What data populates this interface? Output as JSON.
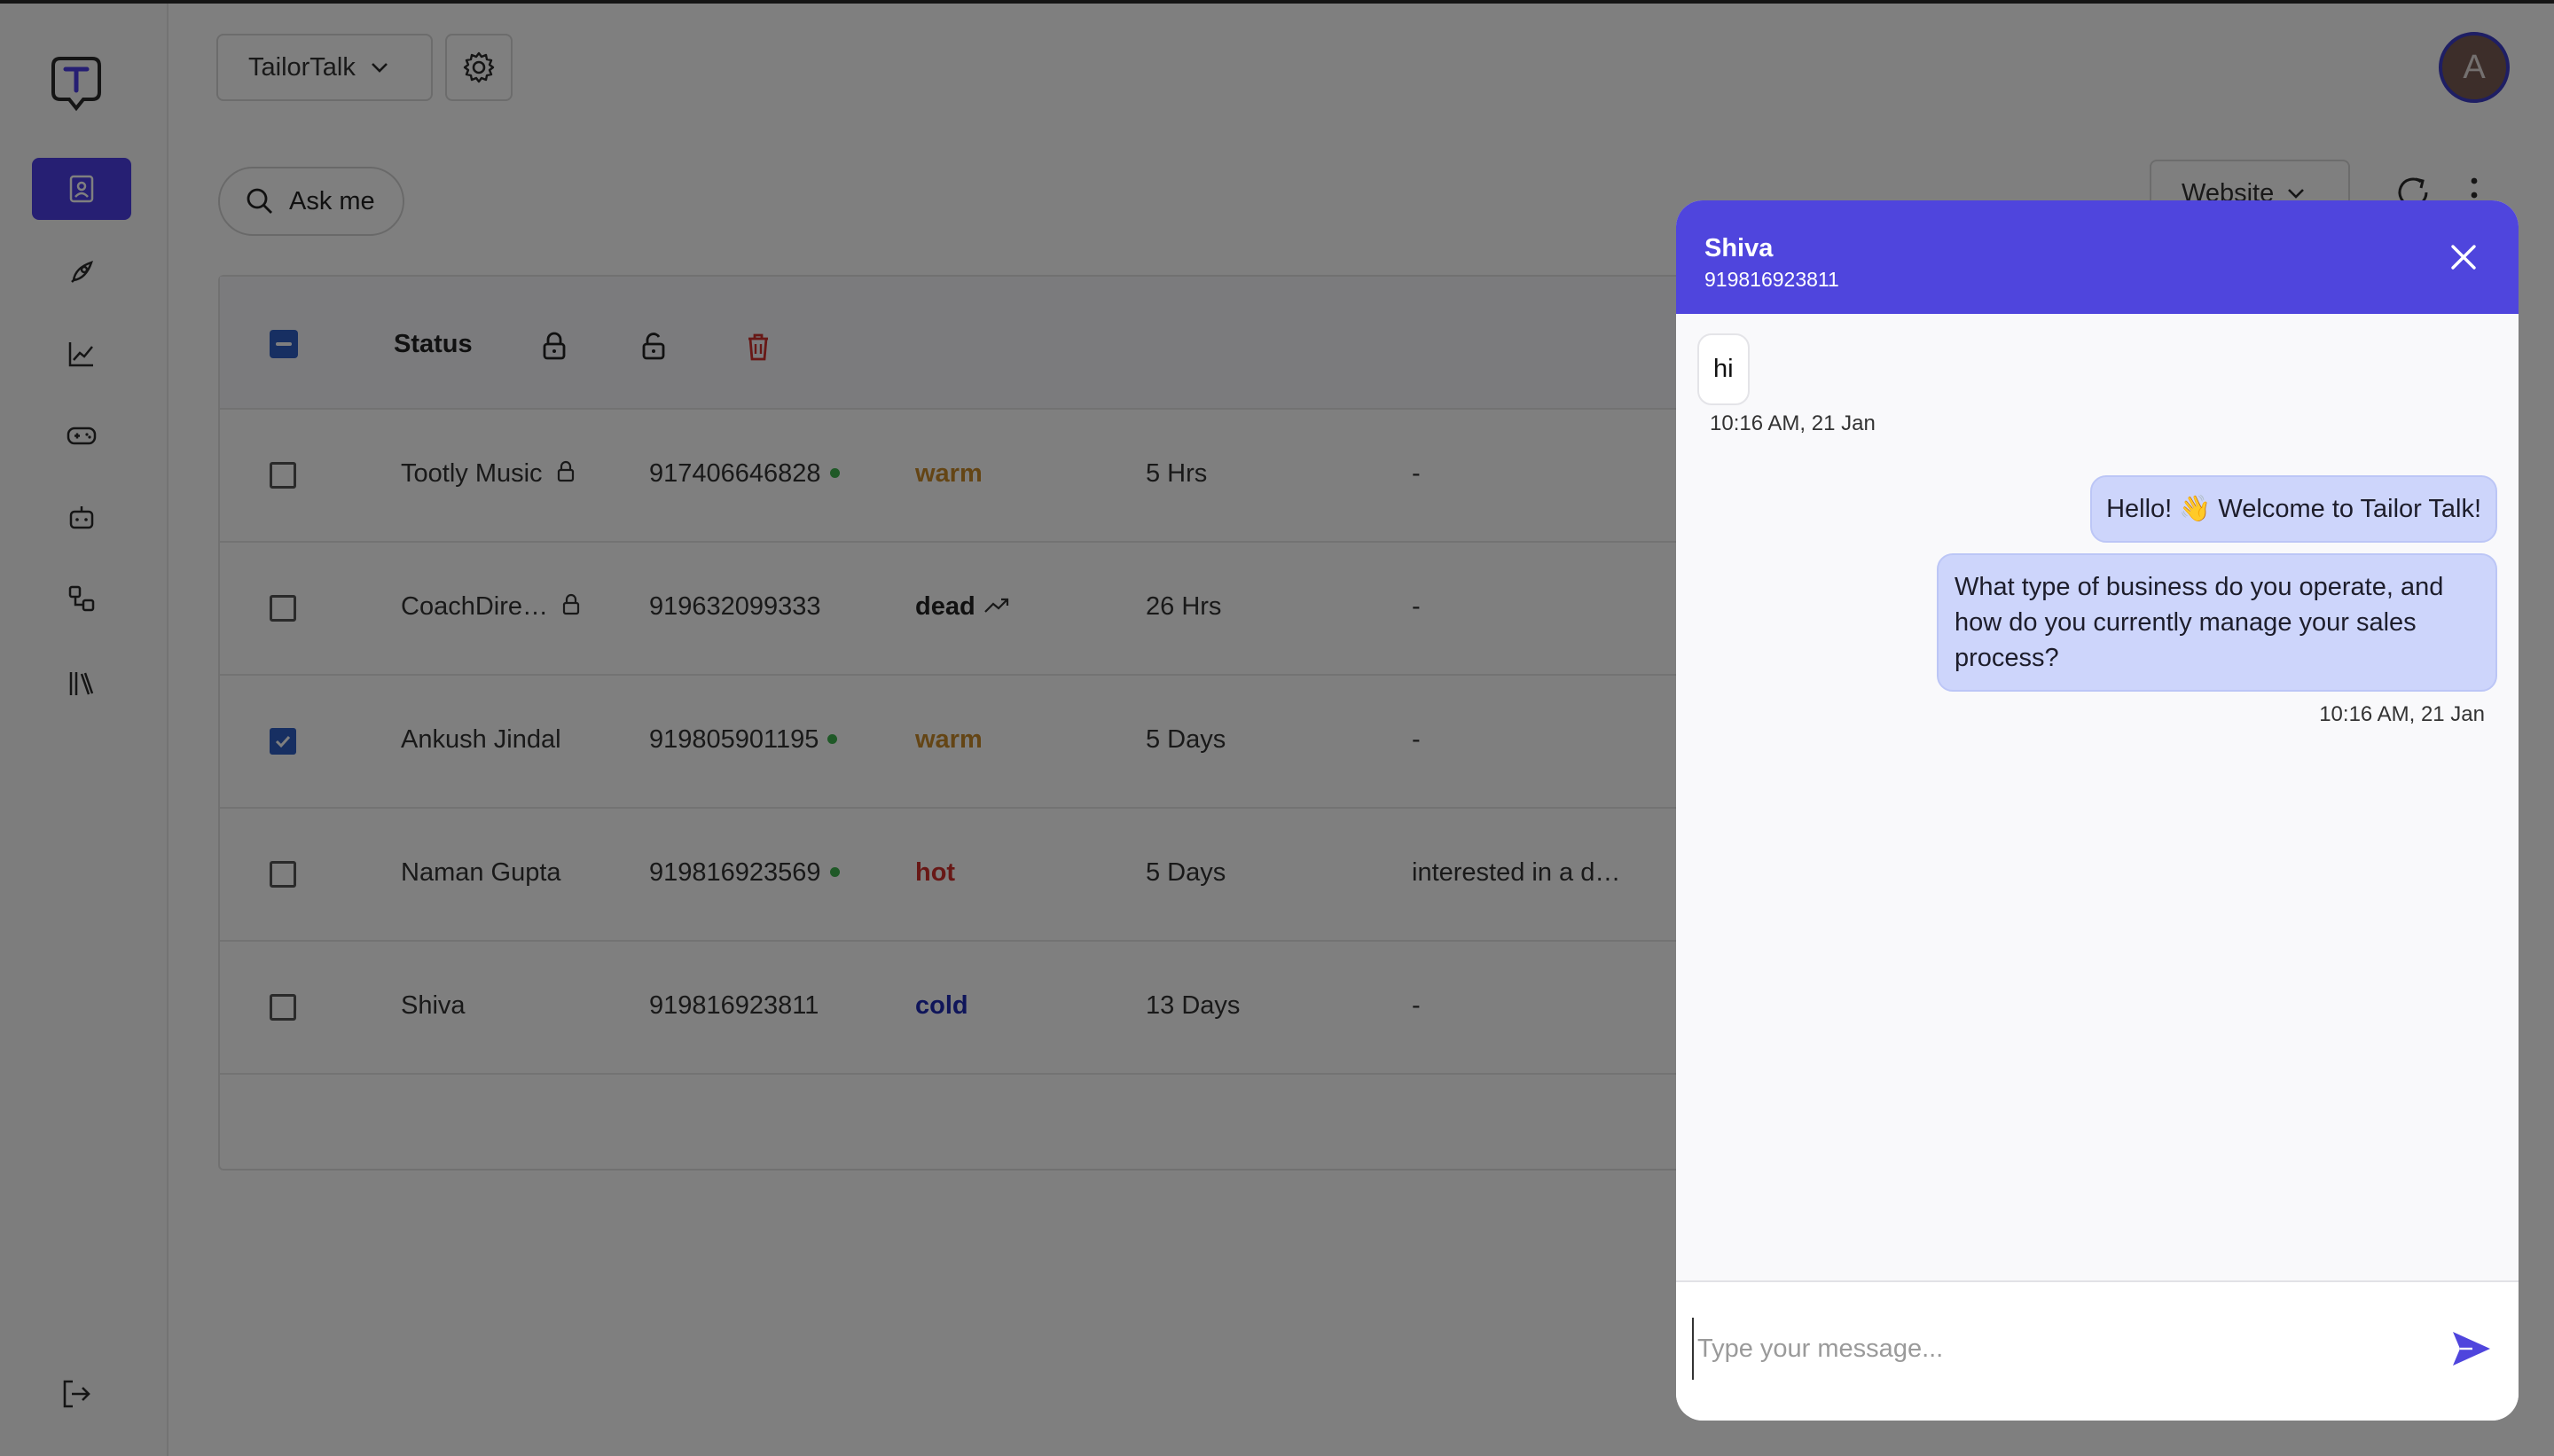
{
  "app": {
    "org_name": "TailorTalk",
    "avatar_initial": "A"
  },
  "search": {
    "ask_label": "Ask me"
  },
  "filters": {
    "source_label": "Website"
  },
  "table": {
    "header_status": "Status",
    "rows": [
      {
        "name": "Tootly Music",
        "phone": "917406646828",
        "status": "warm",
        "status_color": "#c98a2a",
        "time": "5 Hrs",
        "note": "-"
      },
      {
        "name": "CoachDire…",
        "phone": "919632099333",
        "status": "dead",
        "status_color": "#222222",
        "time": "26 Hrs",
        "note": "-"
      },
      {
        "name": "Ankush Jindal",
        "phone": "919805901195",
        "status": "warm",
        "status_color": "#c98a2a",
        "time": "5 Days",
        "note": "-"
      },
      {
        "name": "Naman Gupta",
        "phone": "919816923569",
        "status": "hot",
        "status_color": "#d0312d",
        "time": "5 Days",
        "note": "interested in a de…"
      },
      {
        "name": "Shiva",
        "phone": "919816923811",
        "status": "cold",
        "status_color": "#1f2ab5",
        "time": "13 Days",
        "note": "-"
      }
    ]
  },
  "chat": {
    "contact_name": "Shiva",
    "contact_phone": "919816923811",
    "messages": [
      {
        "direction": "in",
        "text": "hi",
        "time": "10:16 AM, 21 Jan"
      },
      {
        "direction": "out",
        "text": "Hello! 👋 Welcome to Tailor Talk!"
      },
      {
        "direction": "out",
        "text": "What type of business do you operate, and how do you currently manage your sales process?",
        "time": "10:16 AM, 21 Jan"
      }
    ],
    "input_placeholder": "Type your message...",
    "accent_color": "#4f45dd"
  }
}
